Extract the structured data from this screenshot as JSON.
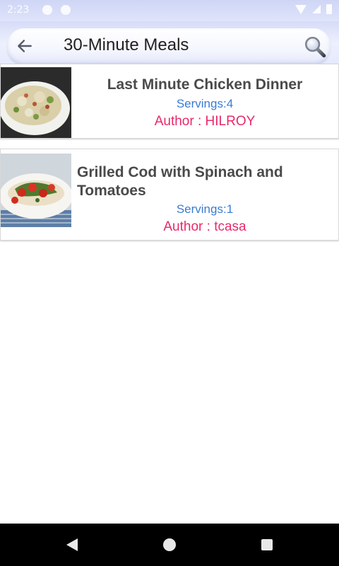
{
  "status_bar": {
    "time": "2:23",
    "icons": [
      "notification-icon",
      "sync-icon",
      "wifi-icon",
      "signal-icon",
      "battery-icon"
    ]
  },
  "app_bar": {
    "title": "30-Minute Meals",
    "back_icon": "arrow-left-icon",
    "search_icon": "magnifier-icon"
  },
  "recipes": [
    {
      "title": "Last Minute Chicken Dinner",
      "servings": "Servings:4",
      "author": "Author : HILROY",
      "image": "chicken-pasta-dish-photo"
    },
    {
      "title": "Grilled Cod with Spinach and Tomatoes",
      "servings": "Servings:1",
      "author": "Author : tcasa",
      "image": "grilled-cod-dish-photo"
    }
  ],
  "colors": {
    "appbar_bg": "#dfe4fb",
    "title_text": "#4a4a4a",
    "servings_text": "#3a7bd5",
    "author_text": "#e8296b",
    "nav_bg": "#000000"
  },
  "nav_bar": {
    "buttons": [
      "back-triangle-icon",
      "home-circle-icon",
      "recents-square-icon"
    ]
  }
}
